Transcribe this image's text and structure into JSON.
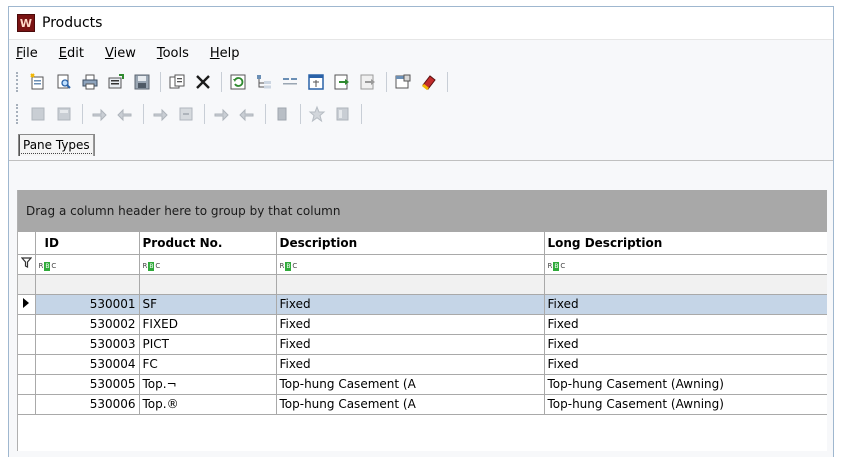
{
  "window": {
    "title": "Products",
    "app_icon_letter": "W",
    "app_icon_color": "#7a1313"
  },
  "menubar": {
    "items": [
      {
        "mnemonic": "F",
        "rest": "ile"
      },
      {
        "mnemonic": "E",
        "rest": "dit"
      },
      {
        "mnemonic": "V",
        "rest": "iew"
      },
      {
        "mnemonic": "T",
        "rest": "ools"
      },
      {
        "mnemonic": "H",
        "rest": "elp"
      }
    ]
  },
  "toolbar1": {
    "icons": [
      "new-record-icon",
      "print-preview-icon",
      "print-icon",
      "export-icon",
      "save-icon",
      "copy-icon",
      "delete-icon",
      "refresh-icon",
      "tree-icon",
      "list-icon",
      "window-icon",
      "import-icon",
      "export-page-icon",
      "properties-icon",
      "erase-icon"
    ]
  },
  "toolbar2": {
    "icons": [
      "disabled-doc-icon",
      "disabled-doc2-icon",
      "disabled-forward-icon",
      "disabled-back-icon",
      "disabled-next-icon",
      "disabled-prev-icon",
      "disabled-move-icon",
      "disabled-return-icon",
      "disabled-lock-icon",
      "disabled-star-icon",
      "disabled-book-icon"
    ]
  },
  "tabs": {
    "pane_types": "Pane Types"
  },
  "grid": {
    "group_prompt": "Drag a column header here to group by that column",
    "columns": [
      "ID",
      "Product No.",
      "Description",
      "Long Description"
    ],
    "filter_label_left": "R",
    "filter_label_mid": "B",
    "filter_label_right": "C",
    "rows": [
      {
        "id": "530001",
        "product_no": "SF",
        "description": "Fixed",
        "long_description": "Fixed",
        "selected": true
      },
      {
        "id": "530002",
        "product_no": "FIXED",
        "description": "Fixed",
        "long_description": "Fixed",
        "selected": false
      },
      {
        "id": "530003",
        "product_no": "PICT",
        "description": "Fixed",
        "long_description": "Fixed",
        "selected": false
      },
      {
        "id": "530004",
        "product_no": "FC",
        "description": "Fixed",
        "long_description": "Fixed",
        "selected": false
      },
      {
        "id": "530005",
        "product_no": "Top.¬",
        "description": "Top-hung Casement (A",
        "long_description": "Top-hung Casement (Awning)",
        "selected": false
      },
      {
        "id": "530006",
        "product_no": "Top.®",
        "description": "Top-hung Casement (A",
        "long_description": "Top-hung Casement (Awning)",
        "selected": false
      }
    ]
  },
  "colors": {
    "selected_row": "#c5d5e7",
    "group_panel": "#a8a8a8",
    "window_border": "#9fb7cf"
  }
}
